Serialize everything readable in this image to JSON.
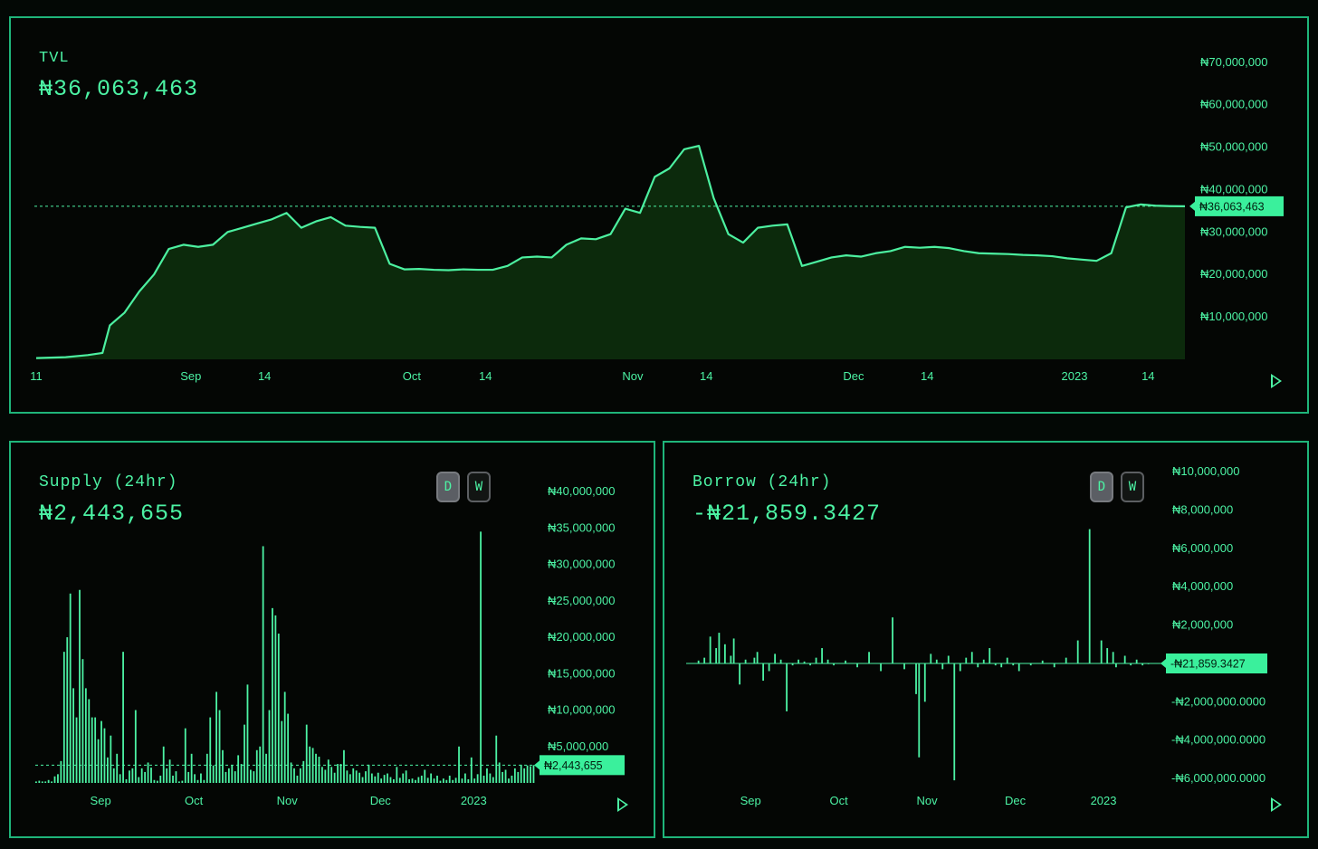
{
  "tvl": {
    "title": "TVL",
    "value": "₦36,063,463",
    "badge": "₦36,063,463",
    "play_icon": "play-icon"
  },
  "supply": {
    "title": "Supply (24hr)",
    "value": "₦2,443,655",
    "badge": "₦2,443,655",
    "toggle_d": "D",
    "toggle_w": "W",
    "active_toggle": "D"
  },
  "borrow": {
    "title": "Borrow (24hr)",
    "value": "-₦21,859.3427",
    "badge": "-₦21,859.3427",
    "toggle_d": "D",
    "toggle_w": "W",
    "active_toggle": "D"
  },
  "colors": {
    "accent": "#4cf3a4",
    "line": "#4cf0a0",
    "area": "#0c2a0c",
    "border": "#1fb57a",
    "background": "#040604"
  },
  "chart_data": [
    {
      "type": "area",
      "title": "TVL",
      "ylim": [
        0,
        74000000
      ],
      "y_ticks": [
        "₦10,000,000",
        "₦20,000,000",
        "₦30,000,000",
        "₦40,000,000",
        "₦50,000,000",
        "₦60,000,000",
        "₦70,000,000"
      ],
      "y_tick_values": [
        10000000,
        20000000,
        30000000,
        40000000,
        50000000,
        60000000,
        70000000
      ],
      "x_ticks": [
        "11",
        "Sep",
        "14",
        "Oct",
        "14",
        "Nov",
        "14",
        "Dec",
        "14",
        "2023",
        "14"
      ],
      "x_tick_days": [
        0,
        21,
        31,
        51,
        61,
        81,
        91,
        111,
        121,
        141,
        151
      ],
      "x_range_days": [
        0,
        156
      ],
      "reference_line": 36063463,
      "series": [
        {
          "x_days": [
            0,
            4,
            7,
            9,
            10,
            12,
            14,
            16,
            18,
            20,
            22,
            24,
            26,
            28,
            30,
            32,
            34,
            36,
            38,
            40,
            42,
            44,
            46,
            48,
            50,
            52,
            54,
            56,
            58,
            60,
            62,
            64,
            66,
            68,
            70,
            72,
            74,
            76,
            78,
            80,
            82,
            84,
            86,
            88,
            90,
            92,
            94,
            96,
            98,
            100,
            102,
            104,
            106,
            108,
            110,
            112,
            114,
            116,
            118,
            120,
            122,
            124,
            126,
            128,
            130,
            132,
            134,
            136,
            138,
            140,
            142,
            144,
            146,
            148,
            150,
            152,
            154,
            156
          ],
          "values": [
            300000,
            500000,
            1000000,
            1500000,
            8000000,
            11000000,
            16000000,
            20000000,
            26000000,
            27000000,
            26500000,
            27000000,
            30000000,
            31000000,
            32000000,
            33000000,
            34500000,
            31000000,
            32500000,
            33500000,
            31500000,
            31200000,
            31000000,
            22500000,
            21200000,
            21300000,
            21100000,
            21000000,
            21200000,
            21100000,
            21100000,
            22000000,
            24000000,
            24200000,
            24000000,
            27000000,
            28500000,
            28300000,
            29500000,
            35500000,
            34500000,
            43000000,
            45000000,
            49500000,
            50300000,
            38000000,
            29500000,
            27500000,
            31000000,
            31500000,
            31800000,
            22000000,
            23000000,
            24000000,
            24500000,
            24200000,
            25000000,
            25500000,
            26500000,
            26300000,
            26500000,
            26200000,
            25500000,
            25000000,
            24900000,
            24800000,
            24600000,
            24500000,
            24300000,
            23800000,
            23500000,
            23200000,
            25000000,
            35800000,
            36500000,
            36200000,
            36100000,
            36063463
          ]
        }
      ]
    },
    {
      "type": "bar",
      "title": "Supply (24hr)",
      "ylim": [
        0,
        42000000
      ],
      "y_ticks": [
        "₦5,000,000",
        "₦10,000,000",
        "₦15,000,000",
        "₦20,000,000",
        "₦25,000,000",
        "₦30,000,000",
        "₦35,000,000",
        "₦40,000,000"
      ],
      "y_tick_values": [
        5000000,
        10000000,
        15000000,
        20000000,
        25000000,
        30000000,
        35000000,
        40000000
      ],
      "x_ticks": [
        "Sep",
        "Oct",
        "Nov",
        "Dec",
        "2023"
      ],
      "x_tick_days": [
        21,
        51,
        81,
        111,
        141
      ],
      "x_range_days": [
        0,
        161
      ],
      "reference_line": 2443655,
      "series": [
        {
          "name": "Supply",
          "x_days": [
            0,
            1,
            2,
            3,
            4,
            5,
            6,
            7,
            8,
            9,
            10,
            11,
            12,
            13,
            14,
            15,
            16,
            17,
            18,
            19,
            20,
            21,
            22,
            23,
            24,
            25,
            26,
            27,
            28,
            29,
            30,
            31,
            32,
            33,
            34,
            35,
            36,
            37,
            38,
            39,
            40,
            41,
            42,
            43,
            44,
            45,
            46,
            47,
            48,
            49,
            50,
            51,
            52,
            53,
            54,
            55,
            56,
            57,
            58,
            59,
            60,
            61,
            62,
            63,
            64,
            65,
            66,
            67,
            68,
            69,
            70,
            71,
            72,
            73,
            74,
            75,
            76,
            77,
            78,
            79,
            80,
            81,
            82,
            83,
            84,
            85,
            86,
            87,
            88,
            89,
            90,
            91,
            92,
            93,
            94,
            95,
            96,
            97,
            98,
            99,
            100,
            101,
            102,
            103,
            104,
            105,
            106,
            107,
            108,
            109,
            110,
            111,
            112,
            113,
            114,
            115,
            116,
            117,
            118,
            119,
            120,
            121,
            122,
            123,
            124,
            125,
            126,
            127,
            128,
            129,
            130,
            131,
            132,
            133,
            134,
            135,
            136,
            137,
            138,
            139,
            140,
            141,
            142,
            143,
            144,
            145,
            146,
            147,
            148,
            149,
            150,
            151,
            152,
            153,
            154,
            155,
            156,
            157,
            158,
            159,
            160
          ],
          "values": [
            200000,
            300000,
            200000,
            200000,
            400000,
            200000,
            900000,
            1200000,
            3000000,
            18000000,
            20000000,
            26000000,
            13000000,
            9000000,
            26500000,
            17000000,
            13000000,
            11500000,
            9000000,
            9000000,
            6000000,
            8500000,
            7500000,
            3500000,
            6500000,
            2000000,
            4000000,
            1200000,
            18000000,
            500000,
            1700000,
            2000000,
            10000000,
            800000,
            2000000,
            1500000,
            2800000,
            2100000,
            400000,
            300000,
            1000000,
            5000000,
            2000000,
            3200000,
            1000000,
            1600000,
            200000,
            300000,
            7500000,
            1500000,
            4000000,
            1200000,
            400000,
            1300000,
            400000,
            4000000,
            9000000,
            2400000,
            12500000,
            10000000,
            4500000,
            1500000,
            2000000,
            2400000,
            1600000,
            3800000,
            2600000,
            8000000,
            13500000,
            1800000,
            1600000,
            4500000,
            5000000,
            32500000,
            4000000,
            10000000,
            24000000,
            23000000,
            20500000,
            8500000,
            12500000,
            9500000,
            2800000,
            2000000,
            1000000,
            2000000,
            3000000,
            8000000,
            5000000,
            4800000,
            4000000,
            3600000,
            2200000,
            1800000,
            3200000,
            2200000,
            1400000,
            2600000,
            2600000,
            4500000,
            1700000,
            1200000,
            2000000,
            1700000,
            1400000,
            800000,
            1600000,
            2500000,
            1300000,
            900000,
            1400000,
            600000,
            1100000,
            1300000,
            800000,
            500000,
            2200000,
            700000,
            1300000,
            1700000,
            500000,
            600000,
            400000,
            800000,
            1000000,
            1800000,
            700000,
            1300000,
            600000,
            1000000,
            300000,
            600000,
            400000,
            1000000,
            400000,
            700000,
            5000000,
            600000,
            1300000,
            500000,
            3500000,
            600000,
            1200000,
            34500000,
            1000000,
            2000000,
            1300000,
            800000,
            6500000,
            2800000,
            1500000,
            1800000,
            600000,
            1000000,
            2000000,
            1500000,
            2500000,
            2000000,
            2400000,
            2300000,
            2443655
          ]
        }
      ]
    },
    {
      "type": "bar",
      "title": "Borrow (24hr)",
      "ylim": [
        -6800000000,
        10300000
      ],
      "y_ticks": [
        "₦10,000,000",
        "₦8,000,000",
        "₦6,000,000",
        "₦4,000,000",
        "₦2,000,000",
        "-₦2,000,000.0000",
        "-₦4,000,000.0000",
        "-₦6,000,000.0000"
      ],
      "x_ticks": [
        "Sep",
        "Oct",
        "Nov",
        "Dec",
        "2023"
      ],
      "x_tick_days": [
        21,
        51,
        81,
        111,
        141
      ],
      "x_range_days": [
        0,
        161
      ],
      "reference_line": -21859.3427,
      "series": [
        {
          "name": "Borrow",
          "x_days": [
            3,
            5,
            7,
            9,
            10,
            12,
            14,
            15,
            17,
            19,
            22,
            23,
            25,
            27,
            29,
            31,
            33,
            35,
            37,
            39,
            41,
            43,
            45,
            47,
            49,
            53,
            57,
            61,
            65,
            69,
            73,
            77,
            78,
            80,
            82,
            84,
            86,
            88,
            90,
            92,
            94,
            96,
            98,
            100,
            102,
            104,
            106,
            108,
            110,
            112,
            116,
            120,
            124,
            128,
            132,
            136,
            140,
            142,
            144,
            145,
            148,
            150,
            152,
            154,
            156
          ],
          "values": [
            150000,
            300000,
            1400000,
            800000,
            1600000,
            1000000,
            400000,
            1300000,
            -1100000000,
            200000,
            300000,
            600000,
            -900000000,
            -400000000,
            500000,
            200000,
            -2500000000,
            -100000000,
            200000,
            100000,
            -100000000,
            300000,
            800000,
            200000,
            -100000000,
            150000,
            -200000000,
            600000,
            -400000000,
            2400000,
            -300000000,
            -1600000000,
            -4900000000,
            -2000000000,
            500000,
            200000,
            -300000000,
            400000,
            -6100000000,
            -400000000,
            300000,
            600000,
            -200000000,
            200000,
            800000,
            -100000000,
            -200000000,
            300000,
            -100000000,
            -400000000,
            -100000000,
            150000,
            -200000000,
            300000,
            1200000,
            7000000,
            1200000,
            800000,
            600000,
            -200000000,
            400000,
            -100000000,
            200000,
            -100000000,
            -21859.3427
          ]
        }
      ]
    }
  ]
}
